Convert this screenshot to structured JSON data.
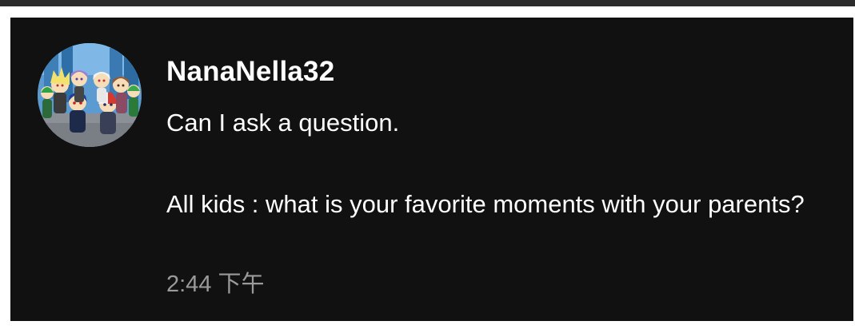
{
  "comment": {
    "author": "NanaNella32",
    "message_lines": [
      "Can I ask a question.",
      "All kids : what is your favorite moments with your parents?"
    ],
    "timestamp": "2:44 下午",
    "avatar_icon": "anime-characters-group-avatar"
  },
  "colors": {
    "card_background": "#111111",
    "author_text": "#ffffff",
    "message_text": "#ffffff",
    "timestamp_text": "#9a9a9a"
  }
}
